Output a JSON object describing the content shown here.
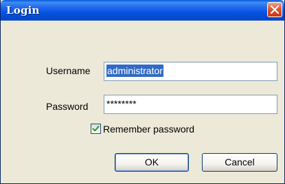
{
  "window": {
    "title": "Login"
  },
  "form": {
    "username_label": "Username",
    "username_value": "administrator",
    "password_label": "Password",
    "password_value": "********",
    "remember_label": "Remember password",
    "remember_checked": true
  },
  "buttons": {
    "ok_label": "OK",
    "cancel_label": "Cancel"
  },
  "colors": {
    "titlebar": "#0553e1",
    "close_button": "#e2552e",
    "selection": "#316ac5",
    "dialog_background": "#ece9d8"
  },
  "icons": {
    "close": "close-icon",
    "check": "checkmark-icon"
  }
}
